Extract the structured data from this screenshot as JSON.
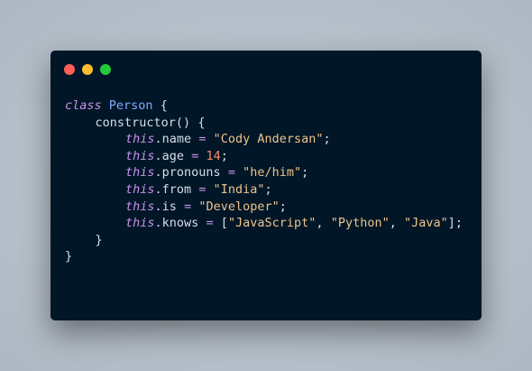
{
  "colors": {
    "background": "#b8c1cb",
    "window": "#011627",
    "close": "#ff5f56",
    "minimize": "#ffbd2e",
    "maximize": "#27c93f",
    "keyword": "#c792ea",
    "class_name": "#82aaff",
    "function": "#d6deeb",
    "property": "#d6deeb",
    "operator": "#c792ea",
    "string": "#ecc48d",
    "number": "#f78c6c",
    "punctuation": "#d6deeb"
  },
  "window_controls": [
    "close-icon",
    "minimize-icon",
    "maximize-icon"
  ],
  "code": {
    "class_keyword": "class",
    "class_name": "Person",
    "open_brace": "{",
    "constructor": "constructor",
    "constructor_parens": "()",
    "constructor_open": "{",
    "this_keyword": "this",
    "dot": ".",
    "assign": "=",
    "semicolon": ";",
    "props": [
      {
        "name": "name",
        "value": "\"Cody Andersan\""
      },
      {
        "name": "age",
        "value": "14"
      },
      {
        "name": "pronouns",
        "value": "\"he/him\""
      },
      {
        "name": "from",
        "value": "\"India\""
      },
      {
        "name": "is",
        "value": "\"Developer\""
      }
    ],
    "knows": {
      "name": "knows",
      "open_bracket": "[",
      "close_bracket": "]",
      "comma": ",",
      "items": [
        "\"JavaScript\"",
        "\"Python\"",
        "\"Java\""
      ]
    },
    "constructor_close": "}",
    "class_close": "}"
  }
}
